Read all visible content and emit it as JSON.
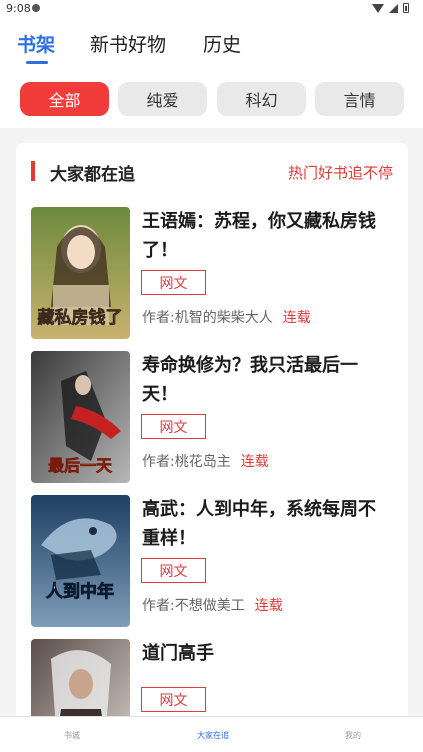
{
  "status_bar": {
    "time": "9:08"
  },
  "top_tabs": [
    {
      "label": "书架",
      "active": true
    },
    {
      "label": "新书好物",
      "active": false
    },
    {
      "label": "历史",
      "active": false
    }
  ],
  "filters": [
    {
      "label": "全部",
      "active": true
    },
    {
      "label": "纯爱",
      "active": false
    },
    {
      "label": "科幻",
      "active": false
    },
    {
      "label": "言情",
      "active": false
    }
  ],
  "section": {
    "title": "大家都在追",
    "more": "热门好书追不停"
  },
  "books": [
    {
      "title": "王语嫣：苏程，你又藏私房钱了！",
      "tag": "网文",
      "author": "作者:机智的柴柴大人",
      "status": "连载",
      "cover_text": "藏私房钱了",
      "cover_colors": [
        "#6d8a3c",
        "#c9b270"
      ]
    },
    {
      "title": "寿命换修为？我只活最后一天！",
      "tag": "网文",
      "author": "作者:桃花岛主",
      "status": "连载",
      "cover_text": "最后一天",
      "cover_colors": [
        "#3a3a3a",
        "#b7b7b7"
      ]
    },
    {
      "title": "高武：人到中年，系统每周不重样！",
      "tag": "网文",
      "author": "作者:不想做美工",
      "status": "连载",
      "cover_text": "人到中年",
      "cover_colors": [
        "#1f3f63",
        "#7d9db8"
      ]
    },
    {
      "title": "道门高手",
      "tag": "网文",
      "author": "",
      "status": "",
      "cover_text": "",
      "cover_colors": [
        "#5a4d4a",
        "#d9d2cc"
      ]
    }
  ],
  "bottom_nav": [
    {
      "label": "书城",
      "active": false
    },
    {
      "label": "大家在追",
      "active": true
    },
    {
      "label": "我的",
      "active": false
    }
  ],
  "colors": {
    "accent_blue": "#2b6fe0",
    "accent_red": "#e23a3a",
    "chip_active": "#f23c3c"
  }
}
